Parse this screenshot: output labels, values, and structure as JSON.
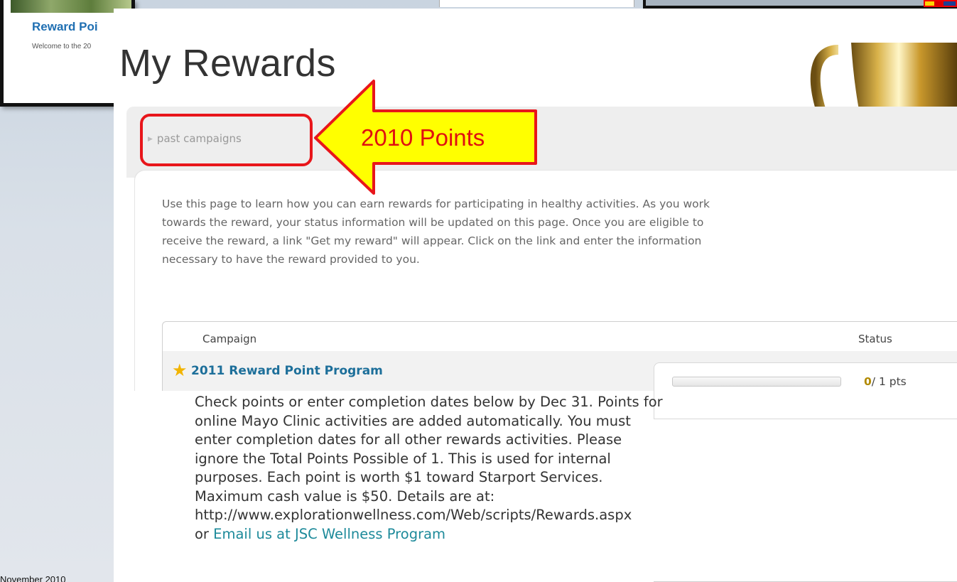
{
  "background_slide": {
    "card_title": "Reward Poi",
    "card_subtitle": "Welcome to the 20",
    "footer_date": "November 2010"
  },
  "page": {
    "title": "My Rewards",
    "past_campaigns_link": "past campaigns",
    "intro": "Use this page to learn how you can earn rewards for participating in healthy activities. As you work towards the reward, your status information will be updated on this page. Once you are eligible to receive the reward, a link \"Get my reward\" will appear. Click on the link and enter the information necessary to have the reward provided to you."
  },
  "table": {
    "headers": {
      "campaign": "Campaign",
      "status": "Status"
    },
    "row": {
      "icon": "star-icon",
      "campaign_name": "2011 Reward Point Program",
      "points_earned": "0",
      "points_total": "/ 1 pts",
      "progress_fraction": 0
    }
  },
  "details": {
    "text": "Check points or enter completion dates below by Dec 31. Points for online Mayo Clinic activities are added automatically. You must enter completion dates for all other rewards activities. Please ignore the Total Points Possible of 1. This is used for internal purposes. Each point is worth $1 toward Starport Services. Maximum cash value is $50. Details are at: http://www.explorationwellness.com/Web/scripts/Rewards.aspx",
    "or_text": "or",
    "email_link": "Email us at JSC Wellness Program"
  },
  "annotation": {
    "label": "2010 Points",
    "arrow_fill": "#ffff00",
    "outline_color": "#e8161b"
  },
  "colors": {
    "link": "#1d6f9a",
    "star": "#f2b400",
    "title_text": "#333333"
  }
}
